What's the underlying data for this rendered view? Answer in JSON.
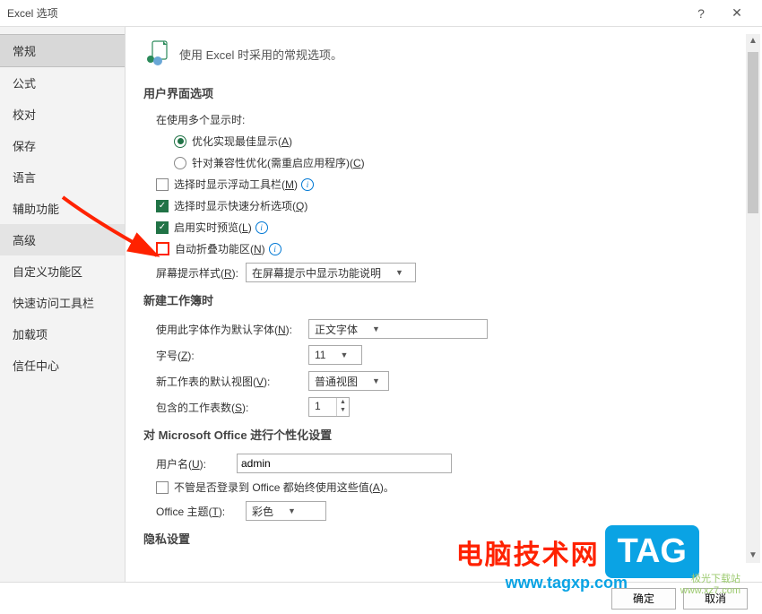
{
  "window": {
    "title": "Excel 选项",
    "help": "?",
    "close": "✕"
  },
  "sidebar": {
    "items": [
      {
        "label": "常规",
        "selected": true
      },
      {
        "label": "公式"
      },
      {
        "label": "校对"
      },
      {
        "label": "保存"
      },
      {
        "label": "语言"
      },
      {
        "label": "辅助功能"
      },
      {
        "label": "高级",
        "hover": true
      },
      {
        "label": "自定义功能区"
      },
      {
        "label": "快速访问工具栏"
      },
      {
        "label": "加载项"
      },
      {
        "label": "信任中心"
      }
    ]
  },
  "header": {
    "text": "使用 Excel 时采用的常规选项。"
  },
  "sections": {
    "ui": {
      "title": "用户界面选项",
      "multi_display_label": "在使用多个显示时:",
      "radio_best": {
        "pre": "优化实现最佳显示(",
        "hot": "A",
        "post": ")"
      },
      "radio_compat": {
        "pre": "针对兼容性优化(需重启应用程序)(",
        "hot": "C",
        "post": ")"
      },
      "cb_float_toolbar": {
        "pre": "选择时显示浮动工具栏(",
        "hot": "M",
        "post": ")"
      },
      "cb_quick_analysis": {
        "pre": "选择时显示快速分析选项(",
        "hot": "Q",
        "post": ")"
      },
      "cb_live_preview": {
        "pre": "启用实时预览(",
        "hot": "L",
        "post": ")"
      },
      "cb_auto_collapse": {
        "pre": "自动折叠功能区(",
        "hot": "N",
        "post": ")"
      },
      "tip_style_label": {
        "pre": "屏幕提示样式(",
        "hot": "R",
        "post": "):"
      },
      "tip_style_value": "在屏幕提示中显示功能说明"
    },
    "newbook": {
      "title": "新建工作簿时",
      "font_label": {
        "pre": "使用此字体作为默认字体(",
        "hot": "N",
        "post": "):"
      },
      "font_value": "正文字体",
      "size_label": {
        "pre": "字号(",
        "hot": "Z",
        "post": "):"
      },
      "size_value": "11",
      "view_label": {
        "pre": "新工作表的默认视图(",
        "hot": "V",
        "post": "):"
      },
      "view_value": "普通视图",
      "sheets_label": {
        "pre": "包含的工作表数(",
        "hot": "S",
        "post": "):"
      },
      "sheets_value": "1"
    },
    "personalize": {
      "title": "对 Microsoft Office 进行个性化设置",
      "username_label": {
        "pre": "用户名(",
        "hot": "U",
        "post": "):"
      },
      "username_value": "admin",
      "always_use": {
        "pre": "不管是否登录到 Office 都始终使用这些值(",
        "hot": "A",
        "post": ")。"
      },
      "theme_label": {
        "pre": "Office 主题(",
        "hot": "T",
        "post": "):"
      },
      "theme_value": "彩色"
    },
    "privacy": {
      "title": "隐私设置"
    }
  },
  "footer": {
    "ok": "确定",
    "cancel": "取消"
  },
  "overlay": {
    "brand1": "电脑技术网",
    "brand2": "TAG",
    "url": "www.tagxp.com",
    "dlsite1": "极光下载站",
    "dlsite2": "www.xz7.com"
  }
}
